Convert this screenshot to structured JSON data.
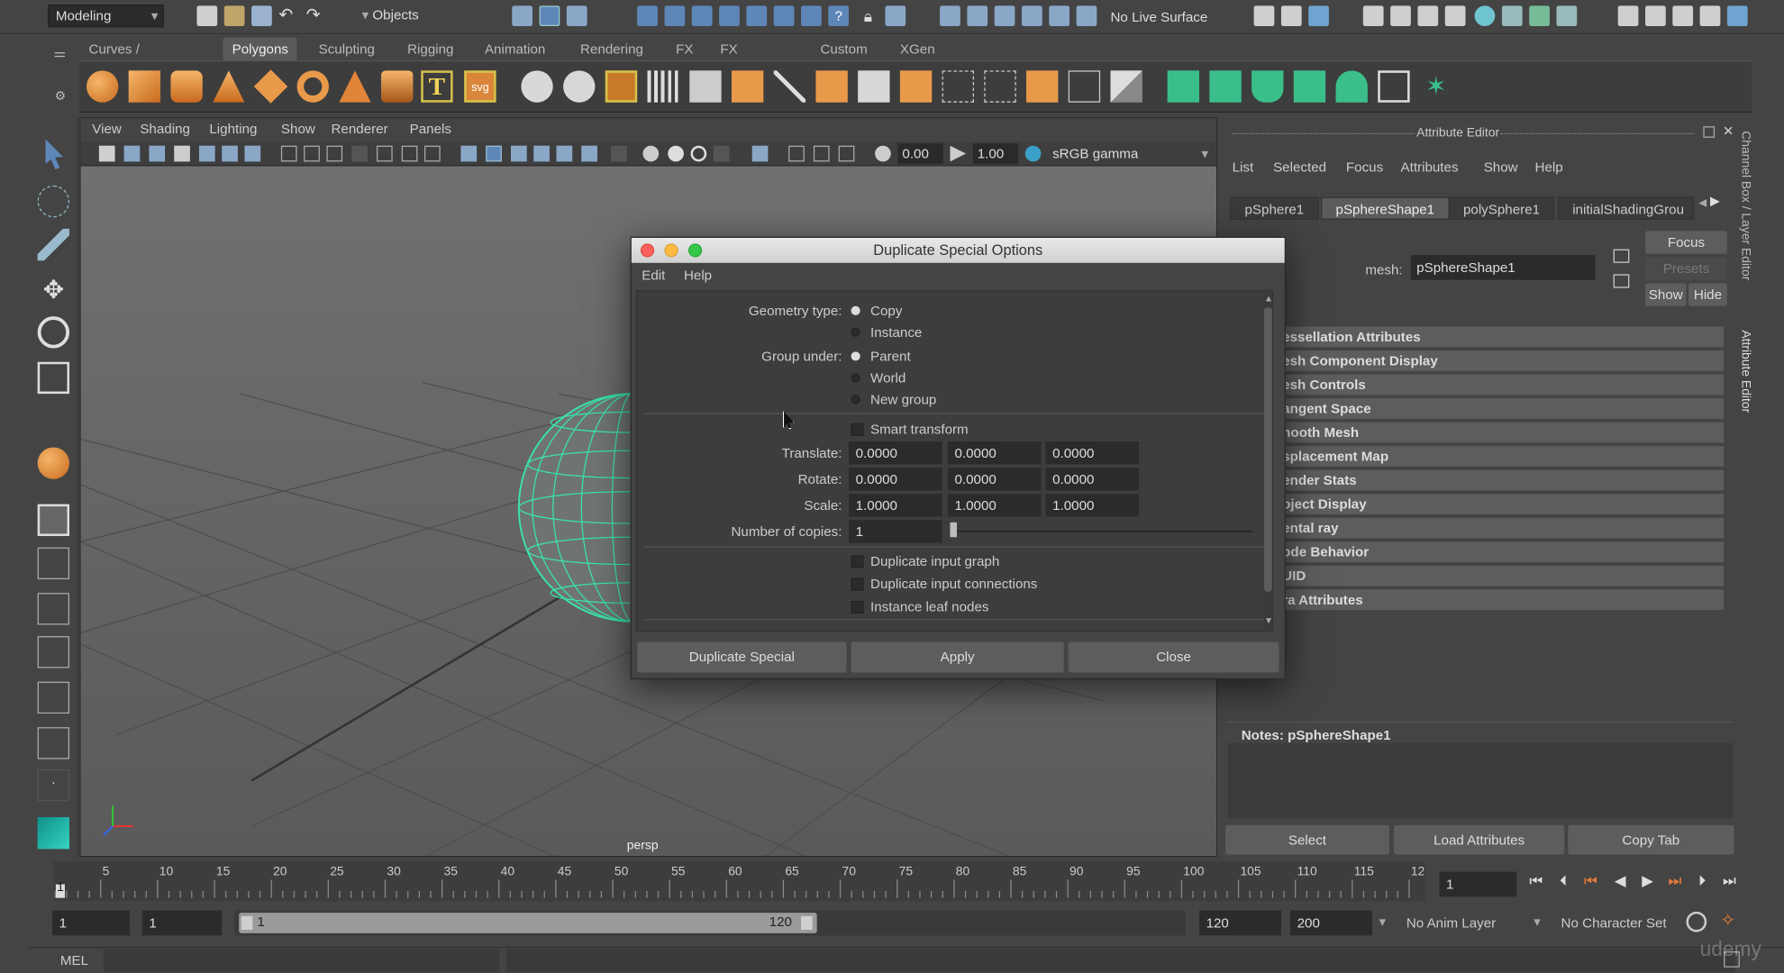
{
  "menubar": {
    "workspace": "Modeling",
    "selection_mode": "Objects",
    "live_surface": "No Live Surface"
  },
  "shelf_tabs": [
    {
      "label": "Curves / Surfaces"
    },
    {
      "label": "Polygons"
    },
    {
      "label": "Sculpting"
    },
    {
      "label": "Rigging"
    },
    {
      "label": "Animation"
    },
    {
      "label": "Rendering"
    },
    {
      "label": "FX"
    },
    {
      "label": "FX Caching"
    },
    {
      "label": "Custom"
    },
    {
      "label": "XGen"
    }
  ],
  "shelf_active": "Polygons",
  "viewport": {
    "menu": [
      "View",
      "Shading",
      "Lighting",
      "Show",
      "Renderer",
      "Panels"
    ],
    "exposure": "0.00",
    "gamma": "1.00",
    "color_space": "sRGB gamma",
    "camera_label": "persp"
  },
  "attribute_editor": {
    "title": "Attribute Editor",
    "menu": [
      "List",
      "Selected",
      "Focus",
      "Attributes",
      "Show",
      "Help"
    ],
    "tabs": [
      "pSphere1",
      "pSphereShape1",
      "polySphere1",
      "initialShadingGrou"
    ],
    "active_tab": "pSphereShape1",
    "mesh_label": "mesh:",
    "mesh_value": "pSphereShape1",
    "focus_btn": "Focus",
    "presets_btn": "Presets",
    "show_btn": "Show",
    "hide_btn": "Hide",
    "sections": [
      "essellation Attributes",
      "esh Component Display",
      "esh Controls",
      "angent Space",
      "nooth Mesh",
      "splacement Map",
      "ender Stats",
      "oject Display",
      "ental ray",
      "ode Behavior",
      "UID",
      "ra Attributes"
    ],
    "notes_label": "Notes:  pSphereShape1",
    "bottom_buttons": [
      "Select",
      "Load Attributes",
      "Copy Tab"
    ],
    "side_tabs": [
      "Channel Box / Layer Editor",
      "Attribute Editor"
    ]
  },
  "dialog": {
    "title": "Duplicate Special Options",
    "menu": [
      "Edit",
      "Help"
    ],
    "geometry_type_label": "Geometry type:",
    "geometry_options": [
      "Copy",
      "Instance"
    ],
    "geometry_selected": "Copy",
    "group_under_label": "Group under:",
    "group_options": [
      "Parent",
      "World",
      "New group"
    ],
    "group_selected": "Parent",
    "smart_transform": "Smart transform",
    "translate_label": "Translate:",
    "translate": [
      "0.0000",
      "0.0000",
      "0.0000"
    ],
    "rotate_label": "Rotate:",
    "rotate": [
      "0.0000",
      "0.0000",
      "0.0000"
    ],
    "scale_label": "Scale:",
    "scale": [
      "1.0000",
      "1.0000",
      "1.0000"
    ],
    "copies_label": "Number of copies:",
    "copies": "1",
    "checkboxes": [
      "Duplicate input graph",
      "Duplicate input connections",
      "Instance leaf nodes"
    ],
    "buttons": [
      "Duplicate Special",
      "Apply",
      "Close"
    ]
  },
  "timeline": {
    "ticks": [
      "5",
      "10",
      "15",
      "20",
      "25",
      "30",
      "35",
      "40",
      "45",
      "50",
      "55",
      "60",
      "65",
      "70",
      "75",
      "80",
      "85",
      "90",
      "95",
      "100",
      "105",
      "110",
      "115",
      "12"
    ],
    "current_frame_label": "1",
    "current_frame": "1"
  },
  "range": {
    "start": "1",
    "playback_start": "1",
    "slider_start": "1",
    "slider_end": "120",
    "playback_end": "120",
    "end": "200",
    "anim_layer": "No Anim Layer",
    "character_set": "No Character Set"
  },
  "command_line": {
    "label": "MEL"
  },
  "watermark": "udemy"
}
